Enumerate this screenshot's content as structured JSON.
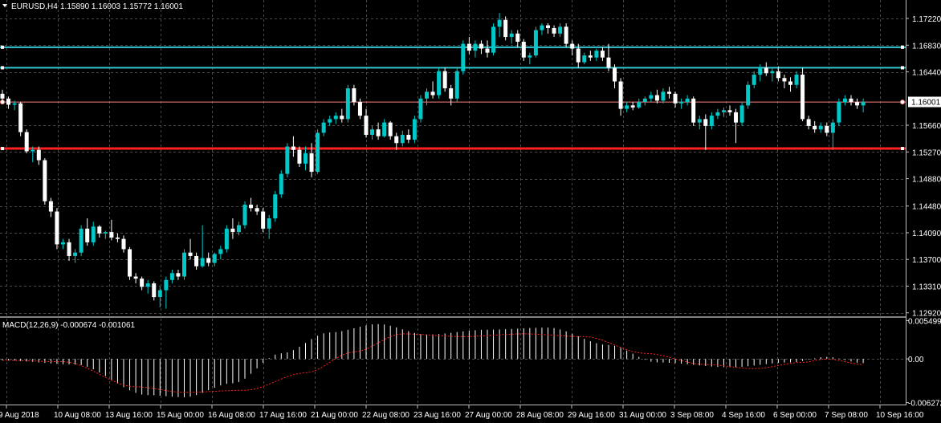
{
  "header": {
    "symbol": "EURUSD,H4",
    "ohlc": "1.15890 1.16003 1.15772 1.16001"
  },
  "macd_header": {
    "label": "MACD(12,26,9) -0.000674 -0.001061"
  },
  "colors": {
    "background": "#000000",
    "grid": "#4a4a4a",
    "bull_candle": "#00c8c8",
    "bear_candle": "#ffffff",
    "resistance": "#32c8d2",
    "support": "#ff2020",
    "current_price_line": "#ff8080",
    "macd_hist": "#ffffff",
    "macd_signal": "#ff2020",
    "axis_text": "#ffffff"
  },
  "chart_data": [
    {
      "type": "candlestick",
      "title": "EURUSD,H4",
      "y_ticks": [
        "1.17220",
        "1.16830",
        "1.16440",
        "1.16001",
        "1.15660",
        "1.15270",
        "1.14880",
        "1.14480",
        "1.14090",
        "1.13700",
        "1.13310",
        "1.12920"
      ],
      "y_range": [
        1.1287,
        1.1749
      ],
      "current_price": "1.16001",
      "x_ticks": [
        "9 Aug 2018",
        "10 Aug 08:00",
        "13 Aug 16:00",
        "15 Aug 00:00",
        "16 Aug 08:00",
        "17 Aug 16:00",
        "21 Aug 00:00",
        "22 Aug 08:00",
        "23 Aug 16:00",
        "27 Aug 00:00",
        "28 Aug 08:00",
        "29 Aug 16:00",
        "31 Aug 00:00",
        "3 Sep 08:00",
        "4 Sep 16:00",
        "6 Sep 00:00",
        "7 Sep 08:00",
        "10 Sep 16:00"
      ],
      "horizontal_lines": [
        {
          "price": 1.168,
          "kind": "resistance"
        },
        {
          "price": 1.165,
          "kind": "resistance"
        },
        {
          "price": 1.16,
          "kind": "current"
        },
        {
          "price": 1.1532,
          "kind": "support"
        }
      ],
      "candles": [
        [
          1.1612,
          1.1618,
          1.1598,
          1.1605
        ],
        [
          1.1605,
          1.1608,
          1.159,
          1.1596
        ],
        [
          1.1596,
          1.1602,
          1.1588,
          1.1598
        ],
        [
          1.1598,
          1.16,
          1.155,
          1.1556
        ],
        [
          1.1556,
          1.156,
          1.1525,
          1.1528
        ],
        [
          1.1528,
          1.1535,
          1.1512,
          1.153
        ],
        [
          1.153,
          1.1535,
          1.1508,
          1.1515
        ],
        [
          1.1515,
          1.1518,
          1.145,
          1.1455
        ],
        [
          1.1455,
          1.146,
          1.1432,
          1.144
        ],
        [
          1.144,
          1.1445,
          1.1385,
          1.1392
        ],
        [
          1.1392,
          1.14,
          1.1385,
          1.1395
        ],
        [
          1.1395,
          1.14,
          1.1368,
          1.1375
        ],
        [
          1.1375,
          1.1385,
          1.1365,
          1.138
        ],
        [
          1.138,
          1.142,
          1.1375,
          1.1415
        ],
        [
          1.1415,
          1.143,
          1.139,
          1.1395
        ],
        [
          1.1395,
          1.1425,
          1.139,
          1.1418
        ],
        [
          1.1418,
          1.142,
          1.1402,
          1.1408
        ],
        [
          1.1408,
          1.1412,
          1.14,
          1.141
        ],
        [
          1.141,
          1.1428,
          1.1398,
          1.1402
        ],
        [
          1.1402,
          1.1408,
          1.1395,
          1.14
        ],
        [
          1.14,
          1.1405,
          1.138,
          1.1385
        ],
        [
          1.1385,
          1.1388,
          1.134,
          1.1345
        ],
        [
          1.1345,
          1.135,
          1.1335,
          1.1342
        ],
        [
          1.1342,
          1.1345,
          1.1325,
          1.133
        ],
        [
          1.133,
          1.134,
          1.132,
          1.1335
        ],
        [
          1.1335,
          1.1338,
          1.131,
          1.1315
        ],
        [
          1.1315,
          1.133,
          1.13,
          1.1325
        ],
        [
          1.1325,
          1.1345,
          1.1298,
          1.134
        ],
        [
          1.134,
          1.1355,
          1.1335,
          1.135
        ],
        [
          1.135,
          1.1355,
          1.134,
          1.1345
        ],
        [
          1.1345,
          1.1385,
          1.134,
          1.138
        ],
        [
          1.138,
          1.14,
          1.137,
          1.1375
        ],
        [
          1.1375,
          1.138,
          1.1355,
          1.136
        ],
        [
          1.136,
          1.142,
          1.1358,
          1.1372
        ],
        [
          1.1372,
          1.138,
          1.136,
          1.1365
        ],
        [
          1.1365,
          1.138,
          1.136,
          1.1378
        ],
        [
          1.1378,
          1.139,
          1.137,
          1.1385
        ],
        [
          1.1385,
          1.142,
          1.138,
          1.1415
        ],
        [
          1.1415,
          1.143,
          1.14,
          1.141
        ],
        [
          1.141,
          1.1425,
          1.1405,
          1.142
        ],
        [
          1.142,
          1.1455,
          1.1415,
          1.145
        ],
        [
          1.145,
          1.146,
          1.144,
          1.1445
        ],
        [
          1.1445,
          1.145,
          1.1435,
          1.144
        ],
        [
          1.144,
          1.1445,
          1.141,
          1.1415
        ],
        [
          1.1415,
          1.1435,
          1.14,
          1.143
        ],
        [
          1.143,
          1.147,
          1.1425,
          1.1465
        ],
        [
          1.1465,
          1.15,
          1.146,
          1.1495
        ],
        [
          1.1495,
          1.154,
          1.149,
          1.1535
        ],
        [
          1.1535,
          1.155,
          1.152,
          1.153
        ],
        [
          1.153,
          1.1535,
          1.1505,
          1.151
        ],
        [
          1.151,
          1.1535,
          1.15,
          1.1525
        ],
        [
          1.1525,
          1.154,
          1.149,
          1.1498
        ],
        [
          1.1498,
          1.156,
          1.1495,
          1.1555
        ],
        [
          1.1555,
          1.1575,
          1.155,
          1.157
        ],
        [
          1.157,
          1.158,
          1.1565,
          1.1575
        ],
        [
          1.1575,
          1.1585,
          1.1568,
          1.158
        ],
        [
          1.158,
          1.159,
          1.157,
          1.1575
        ],
        [
          1.1575,
          1.1625,
          1.157,
          1.162
        ],
        [
          1.162,
          1.1625,
          1.1595,
          1.16
        ],
        [
          1.16,
          1.1605,
          1.1575,
          1.158
        ],
        [
          1.158,
          1.159,
          1.1548,
          1.1552
        ],
        [
          1.1552,
          1.1565,
          1.1545,
          1.156
        ],
        [
          1.156,
          1.157,
          1.1545,
          1.155
        ],
        [
          1.155,
          1.1575,
          1.1548,
          1.157
        ],
        [
          1.157,
          1.1572,
          1.1545,
          1.155
        ],
        [
          1.155,
          1.1555,
          1.153,
          1.154
        ],
        [
          1.154,
          1.1558,
          1.1535,
          1.1552
        ],
        [
          1.1552,
          1.156,
          1.154,
          1.1545
        ],
        [
          1.1545,
          1.158,
          1.154,
          1.1575
        ],
        [
          1.1575,
          1.161,
          1.157,
          1.1605
        ],
        [
          1.1605,
          1.162,
          1.1595,
          1.1615
        ],
        [
          1.1615,
          1.163,
          1.1605,
          1.161
        ],
        [
          1.161,
          1.165,
          1.1605,
          1.1645
        ],
        [
          1.1645,
          1.165,
          1.1615,
          1.162
        ],
        [
          1.162,
          1.1625,
          1.1595,
          1.1605
        ],
        [
          1.1605,
          1.165,
          1.16,
          1.1645
        ],
        [
          1.1645,
          1.169,
          1.164,
          1.1685
        ],
        [
          1.1685,
          1.1695,
          1.167,
          1.1675
        ],
        [
          1.1675,
          1.169,
          1.1665,
          1.1685
        ],
        [
          1.1685,
          1.169,
          1.167,
          1.1678
        ],
        [
          1.1678,
          1.169,
          1.1665,
          1.1672
        ],
        [
          1.1672,
          1.1715,
          1.1668,
          1.171
        ],
        [
          1.171,
          1.173,
          1.1695,
          1.172
        ],
        [
          1.172,
          1.1725,
          1.169,
          1.1695
        ],
        [
          1.1695,
          1.1705,
          1.1685,
          1.17
        ],
        [
          1.17,
          1.1705,
          1.168,
          1.1688
        ],
        [
          1.1688,
          1.1692,
          1.166,
          1.1665
        ],
        [
          1.1665,
          1.1672,
          1.1655,
          1.1668
        ],
        [
          1.1668,
          1.171,
          1.1665,
          1.1705
        ],
        [
          1.1705,
          1.1715,
          1.1698,
          1.1712
        ],
        [
          1.1712,
          1.1715,
          1.17,
          1.1708
        ],
        [
          1.1708,
          1.1712,
          1.1695,
          1.17
        ],
        [
          1.17,
          1.1715,
          1.1695,
          1.171
        ],
        [
          1.171,
          1.1715,
          1.168,
          1.1685
        ],
        [
          1.1685,
          1.169,
          1.1668,
          1.1678
        ],
        [
          1.1678,
          1.1685,
          1.165,
          1.1658
        ],
        [
          1.1658,
          1.1672,
          1.1655,
          1.1668
        ],
        [
          1.1668,
          1.1675,
          1.166,
          1.1665
        ],
        [
          1.1665,
          1.1678,
          1.166,
          1.1675
        ],
        [
          1.1675,
          1.168,
          1.166,
          1.1665
        ],
        [
          1.1665,
          1.1685,
          1.1645,
          1.165
        ],
        [
          1.165,
          1.1655,
          1.162,
          1.163
        ],
        [
          1.163,
          1.1635,
          1.158,
          1.159
        ],
        [
          1.159,
          1.16,
          1.1585,
          1.1595
        ],
        [
          1.1595,
          1.16,
          1.1588,
          1.1592
        ],
        [
          1.1592,
          1.1605,
          1.159,
          1.16
        ],
        [
          1.16,
          1.1608,
          1.1595,
          1.1605
        ],
        [
          1.1605,
          1.1615,
          1.16,
          1.161
        ],
        [
          1.161,
          1.1618,
          1.1598,
          1.1602
        ],
        [
          1.1602,
          1.162,
          1.1598,
          1.1615
        ],
        [
          1.1615,
          1.1622,
          1.1605,
          1.1612
        ],
        [
          1.1612,
          1.1615,
          1.1592,
          1.1598
        ],
        [
          1.1598,
          1.1605,
          1.159,
          1.16
        ],
        [
          1.16,
          1.161,
          1.1595,
          1.1605
        ],
        [
          1.1605,
          1.1608,
          1.1565,
          1.157
        ],
        [
          1.157,
          1.158,
          1.156,
          1.1575
        ],
        [
          1.1575,
          1.1582,
          1.153,
          1.1565
        ],
        [
          1.1565,
          1.1585,
          1.156,
          1.158
        ],
        [
          1.158,
          1.159,
          1.1575,
          1.1585
        ],
        [
          1.1585,
          1.1592,
          1.1578,
          1.1588
        ],
        [
          1.1588,
          1.1595,
          1.158,
          1.1585
        ],
        [
          1.1585,
          1.159,
          1.154,
          1.157
        ],
        [
          1.157,
          1.16,
          1.1565,
          1.1595
        ],
        [
          1.1595,
          1.163,
          1.159,
          1.1625
        ],
        [
          1.1625,
          1.1645,
          1.162,
          1.164
        ],
        [
          1.164,
          1.1655,
          1.163,
          1.165
        ],
        [
          1.165,
          1.1658,
          1.1638,
          1.1642
        ],
        [
          1.1642,
          1.165,
          1.163,
          1.1645
        ],
        [
          1.1645,
          1.1652,
          1.163,
          1.1635
        ],
        [
          1.1635,
          1.164,
          1.162,
          1.163
        ],
        [
          1.163,
          1.1636,
          1.1615,
          1.1625
        ],
        [
          1.1625,
          1.1645,
          1.162,
          1.164
        ],
        [
          1.164,
          1.165,
          1.1572,
          1.1575
        ],
        [
          1.1575,
          1.158,
          1.156,
          1.1565
        ],
        [
          1.1565,
          1.1572,
          1.1555,
          1.156
        ],
        [
          1.156,
          1.157,
          1.1555,
          1.1565
        ],
        [
          1.1565,
          1.157,
          1.155,
          1.1555
        ],
        [
          1.1555,
          1.1575,
          1.153,
          1.157
        ],
        [
          1.157,
          1.1605,
          1.1565,
          1.16
        ],
        [
          1.16,
          1.161,
          1.1595,
          1.1605
        ],
        [
          1.1605,
          1.161,
          1.1595,
          1.16
        ],
        [
          1.16,
          1.1605,
          1.159,
          1.1595
        ],
        [
          1.1595,
          1.1605,
          1.1585,
          1.16
        ]
      ]
    },
    {
      "type": "macd",
      "title": "MACD(12,26,9) -0.000674 -0.001061",
      "y_ticks": [
        "0.005499",
        "0.00",
        "-0.006272"
      ],
      "y_range": [
        -0.00655,
        0.00578
      ],
      "histogram_keypoints": [
        [
          0,
          -0.0002
        ],
        [
          12,
          -0.0008
        ],
        [
          24,
          -0.0052
        ],
        [
          30,
          -0.0055
        ],
        [
          38,
          -0.0035
        ],
        [
          46,
          0.0008
        ],
        [
          54,
          0.0038
        ],
        [
          62,
          0.005
        ],
        [
          70,
          0.0035
        ],
        [
          80,
          0.0042
        ],
        [
          90,
          0.0045
        ],
        [
          100,
          0.002
        ],
        [
          108,
          -0.0005
        ],
        [
          120,
          -0.0012
        ],
        [
          130,
          -0.0005
        ],
        [
          136,
          0.0003
        ],
        [
          142,
          -0.0006
        ],
        [
          147,
          -0.0006
        ]
      ],
      "signal_keypoints": [
        [
          0,
          -0.0002
        ],
        [
          10,
          -0.0004
        ],
        [
          22,
          -0.004
        ],
        [
          30,
          -0.0048
        ],
        [
          40,
          -0.0045
        ],
        [
          50,
          -0.002
        ],
        [
          58,
          0.001
        ],
        [
          66,
          0.0036
        ],
        [
          76,
          0.0032
        ],
        [
          86,
          0.0036
        ],
        [
          96,
          0.0032
        ],
        [
          106,
          0.0008
        ],
        [
          116,
          -0.0008
        ],
        [
          124,
          -0.0014
        ],
        [
          132,
          -0.0005
        ],
        [
          136,
          0.0
        ],
        [
          142,
          -0.0008
        ],
        [
          147,
          -0.001
        ]
      ]
    }
  ]
}
